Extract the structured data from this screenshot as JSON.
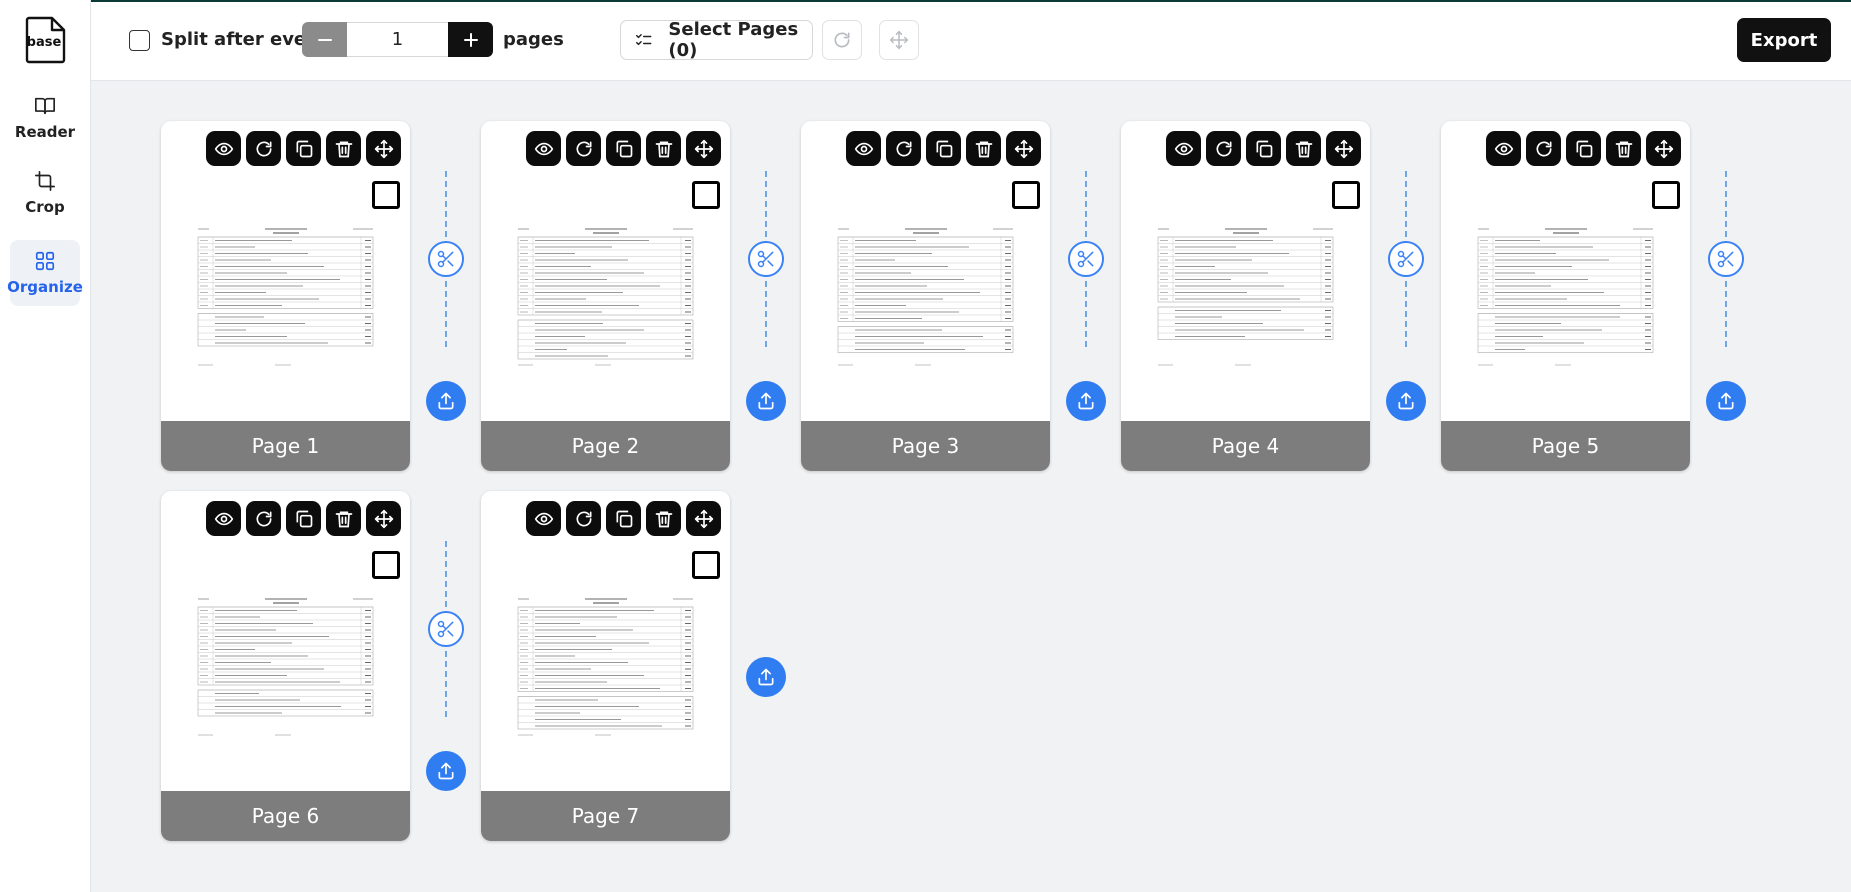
{
  "app": {
    "logo_text": "base"
  },
  "sidebar": {
    "items": [
      {
        "label": "Reader",
        "icon": "book-icon",
        "active": false
      },
      {
        "label": "Crop",
        "icon": "crop-icon",
        "active": false
      },
      {
        "label": "Organize",
        "icon": "grid-icon",
        "active": true
      }
    ]
  },
  "toolbar": {
    "split_label": "Split after every",
    "split_checked": false,
    "split_value": "1",
    "pages_label": "pages",
    "select_pages_label": "Select Pages (0)",
    "export_label": "Export"
  },
  "pages": [
    {
      "label": "Page 1"
    },
    {
      "label": "Page 2"
    },
    {
      "label": "Page 3"
    },
    {
      "label": "Page 4"
    },
    {
      "label": "Page 5"
    },
    {
      "label": "Page 6"
    },
    {
      "label": "Page 7"
    }
  ],
  "colors": {
    "accent": "#2563eb",
    "insert_button": "#2f7df0",
    "footer_bar": "#7d7d7d",
    "export_button": "#111111"
  }
}
